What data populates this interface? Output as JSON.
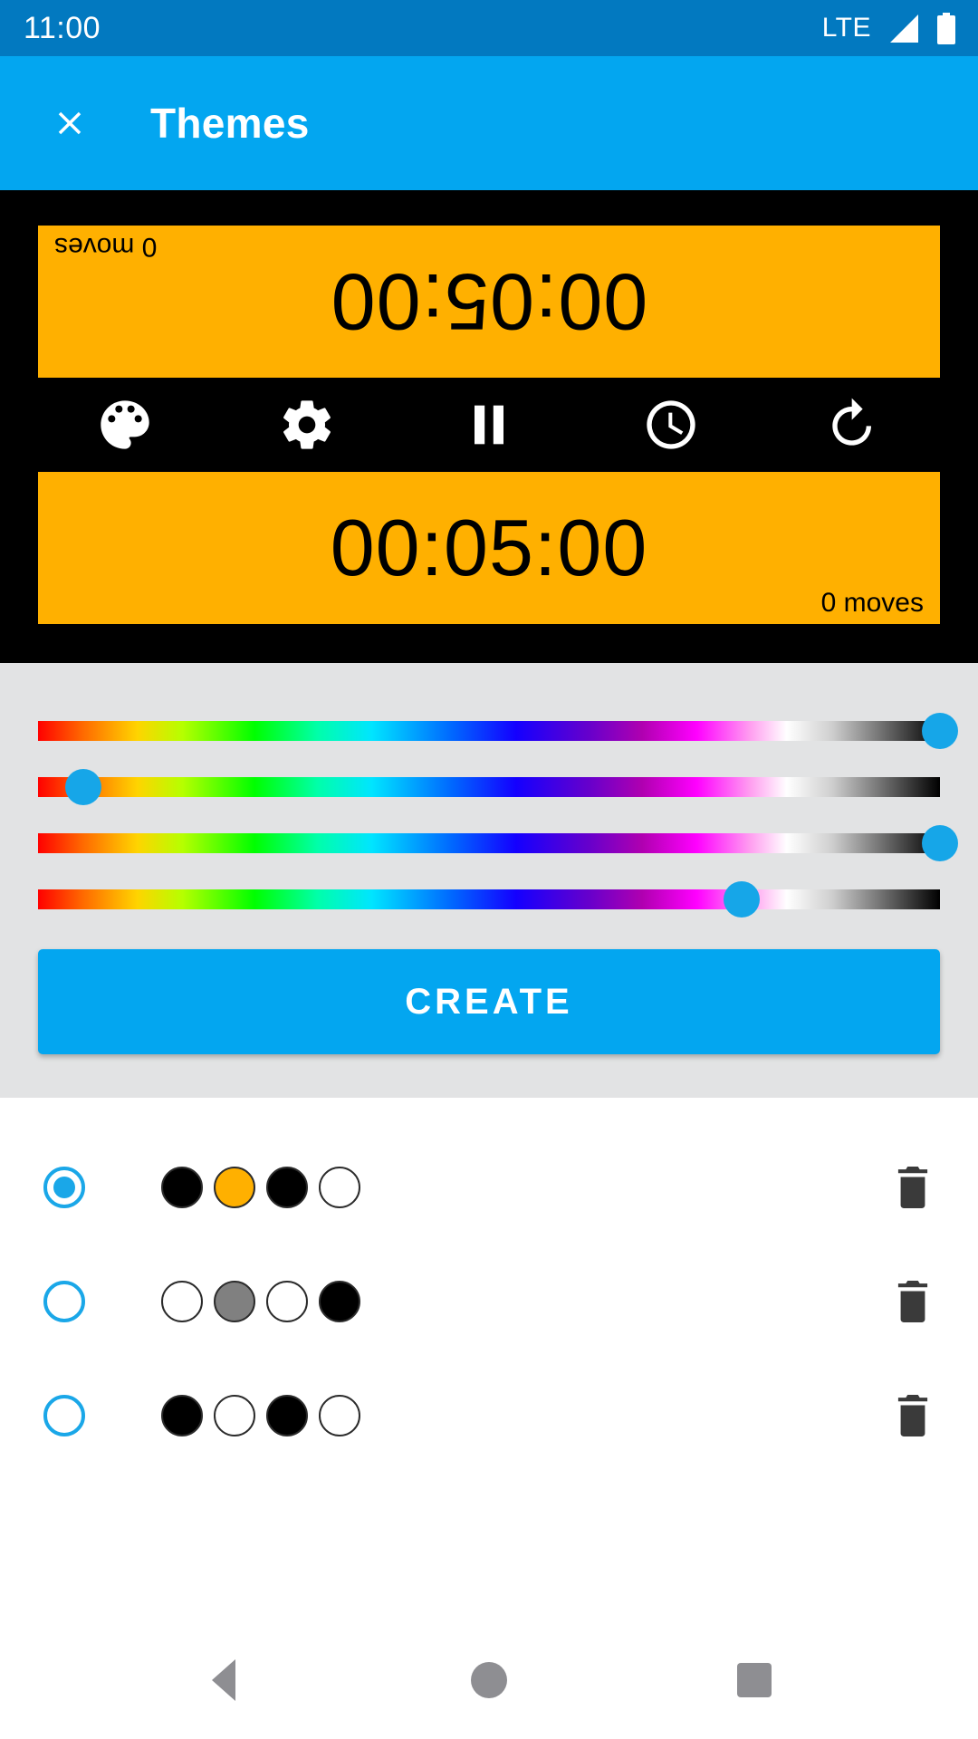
{
  "status_bar": {
    "time": "11:00",
    "network_label": "LTE",
    "signal_icon": "signal-triangle-icon",
    "battery_icon": "battery-full-icon",
    "background_color": "#0279c0"
  },
  "app_bar": {
    "close_icon": "close-x-icon",
    "title": "Themes",
    "background_color": "#03a6f0"
  },
  "preview": {
    "background_color": "#000000",
    "timer_background_color": "#ffb000",
    "timer_text_color": "#000000",
    "top_timer": {
      "time": "00:05:00",
      "moves": "0 moves",
      "orientation": "rotated-180"
    },
    "bottom_timer": {
      "time": "00:05:00",
      "moves": "0 moves",
      "orientation": "normal"
    },
    "controls": [
      {
        "name": "palette-icon",
        "label": "Themes"
      },
      {
        "name": "gear-icon",
        "label": "Settings"
      },
      {
        "name": "pause-icon",
        "label": "Pause"
      },
      {
        "name": "clock-icon",
        "label": "Time"
      },
      {
        "name": "undo-icon",
        "label": "Reset"
      }
    ]
  },
  "editor": {
    "background_color": "#e2e3e4",
    "accent_color": "#16a6e8",
    "sliders": [
      {
        "name": "slider-color-1",
        "value_percent": 100
      },
      {
        "name": "slider-color-2",
        "value_percent": 5
      },
      {
        "name": "slider-color-3",
        "value_percent": 100
      },
      {
        "name": "slider-color-4",
        "value_percent": 78
      }
    ],
    "create_label": "CREATE"
  },
  "theme_list": {
    "rows": [
      {
        "selected": true,
        "swatches": [
          "#000000",
          "#ffb000",
          "#000000",
          "#ffffff"
        ],
        "delete_icon": "trash-icon"
      },
      {
        "selected": false,
        "swatches": [
          "#ffffff",
          "#808080",
          "#ffffff",
          "#000000"
        ],
        "delete_icon": "trash-icon"
      },
      {
        "selected": false,
        "swatches": [
          "#000000",
          "#ffffff",
          "#000000",
          "#ffffff"
        ],
        "delete_icon": "trash-icon"
      }
    ]
  },
  "nav_bar": {
    "back_icon": "nav-back-icon",
    "home_icon": "nav-home-icon",
    "recents_icon": "nav-recents-icon",
    "icon_color": "#8e8e92"
  }
}
